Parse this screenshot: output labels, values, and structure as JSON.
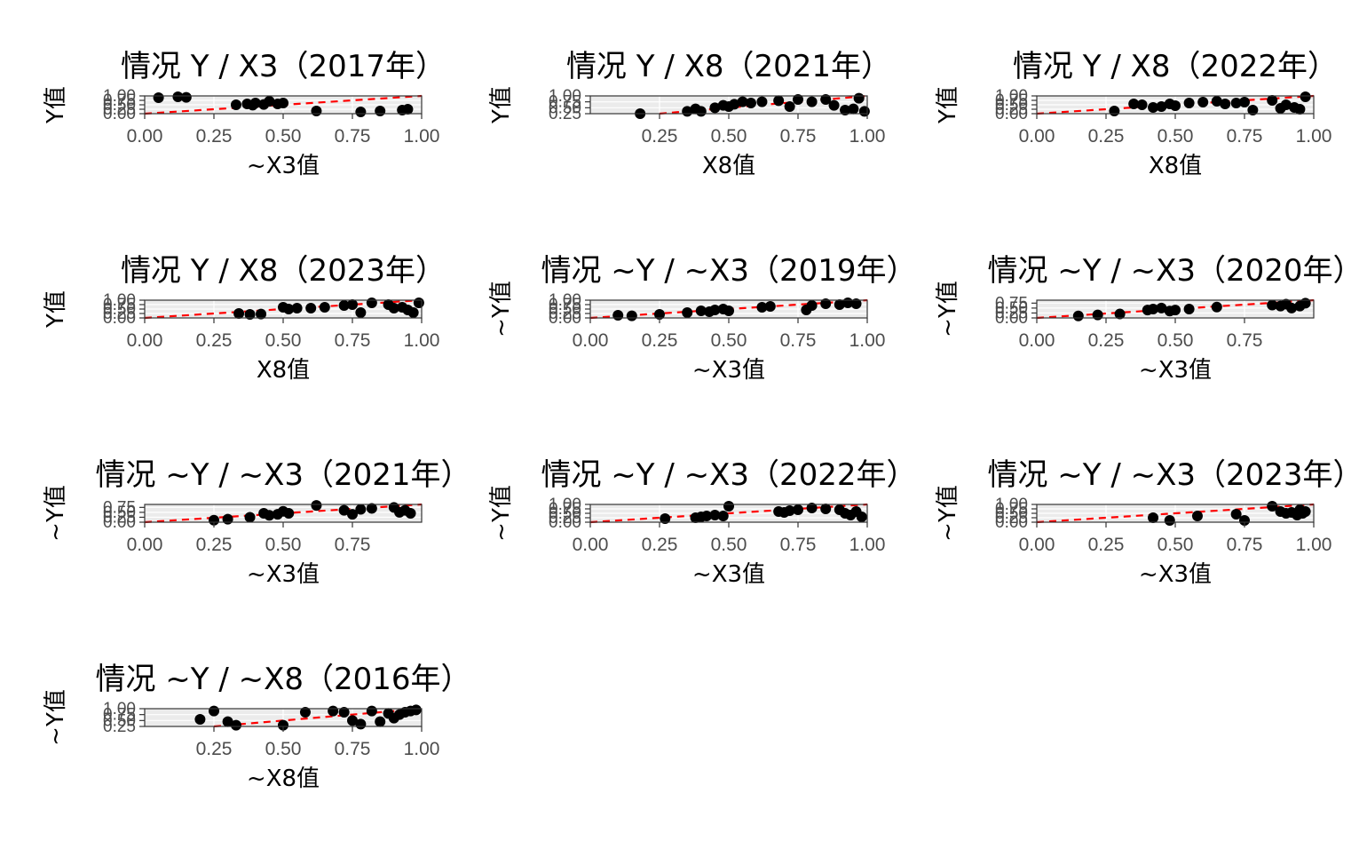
{
  "chart_data": [
    {
      "type": "scatter",
      "title": "情况 Y / X3（2017年）",
      "xlabel": "~X3值",
      "ylabel": "Y值",
      "xlim": [
        0,
        1
      ],
      "ylim": [
        0,
        1
      ],
      "xticks": [
        "0.00",
        "0.25",
        "0.50",
        "0.75",
        "1.00"
      ],
      "yticks": [
        "0.00",
        "0.25",
        "0.50",
        "0.75",
        "1.00"
      ],
      "points": [
        [
          0.05,
          0.9
        ],
        [
          0.12,
          0.95
        ],
        [
          0.15,
          0.92
        ],
        [
          0.33,
          0.5
        ],
        [
          0.37,
          0.55
        ],
        [
          0.39,
          0.48
        ],
        [
          0.4,
          0.6
        ],
        [
          0.43,
          0.52
        ],
        [
          0.45,
          0.7
        ],
        [
          0.48,
          0.55
        ],
        [
          0.5,
          0.6
        ],
        [
          0.62,
          0.15
        ],
        [
          0.78,
          0.1
        ],
        [
          0.85,
          0.15
        ],
        [
          0.93,
          0.2
        ],
        [
          0.95,
          0.25
        ]
      ],
      "trend": [
        [
          0,
          0
        ],
        [
          1,
          1
        ]
      ],
      "grid": true
    },
    {
      "type": "scatter",
      "title": "情况 Y / X8（2021年）",
      "xlabel": "X8值",
      "ylabel": "Y值",
      "xlim": [
        0,
        1
      ],
      "ylim": [
        0.25,
        1
      ],
      "xticks": [
        "0.25",
        "0.50",
        "0.75",
        "1.00"
      ],
      "yticks": [
        "0.25",
        "0.50",
        "0.75",
        "1.00"
      ],
      "points": [
        [
          0.18,
          0.25
        ],
        [
          0.35,
          0.35
        ],
        [
          0.38,
          0.45
        ],
        [
          0.4,
          0.35
        ],
        [
          0.45,
          0.5
        ],
        [
          0.48,
          0.6
        ],
        [
          0.5,
          0.55
        ],
        [
          0.52,
          0.65
        ],
        [
          0.55,
          0.75
        ],
        [
          0.58,
          0.7
        ],
        [
          0.62,
          0.75
        ],
        [
          0.68,
          0.8
        ],
        [
          0.72,
          0.55
        ],
        [
          0.75,
          0.85
        ],
        [
          0.8,
          0.75
        ],
        [
          0.85,
          0.85
        ],
        [
          0.88,
          0.6
        ],
        [
          0.92,
          0.4
        ],
        [
          0.95,
          0.45
        ],
        [
          0.97,
          0.9
        ],
        [
          0.99,
          0.35
        ]
      ],
      "trend": [
        [
          0.25,
          0.25
        ],
        [
          1,
          1
        ]
      ],
      "grid": true
    },
    {
      "type": "scatter",
      "title": "情况 Y / X8（2022年）",
      "xlabel": "X8值",
      "ylabel": "Y值",
      "xlim": [
        0,
        1
      ],
      "ylim": [
        0,
        1
      ],
      "xticks": [
        "0.00",
        "0.25",
        "0.50",
        "0.75",
        "1.00"
      ],
      "yticks": [
        "0.00",
        "0.25",
        "0.50",
        "0.75",
        "1.00"
      ],
      "points": [
        [
          0.28,
          0.15
        ],
        [
          0.35,
          0.55
        ],
        [
          0.38,
          0.5
        ],
        [
          0.42,
          0.35
        ],
        [
          0.45,
          0.4
        ],
        [
          0.48,
          0.55
        ],
        [
          0.5,
          0.45
        ],
        [
          0.55,
          0.6
        ],
        [
          0.6,
          0.65
        ],
        [
          0.65,
          0.7
        ],
        [
          0.68,
          0.55
        ],
        [
          0.72,
          0.6
        ],
        [
          0.75,
          0.65
        ],
        [
          0.78,
          0.2
        ],
        [
          0.85,
          0.75
        ],
        [
          0.88,
          0.3
        ],
        [
          0.9,
          0.5
        ],
        [
          0.93,
          0.35
        ],
        [
          0.95,
          0.25
        ],
        [
          0.97,
          0.95
        ]
      ],
      "trend": [
        [
          0,
          0
        ],
        [
          1,
          1
        ]
      ],
      "grid": true
    },
    {
      "type": "scatter",
      "title": "情况 Y / X8（2023年）",
      "xlabel": "X8值",
      "ylabel": "Y值",
      "xlim": [
        0,
        1
      ],
      "ylim": [
        0,
        1
      ],
      "xticks": [
        "0.00",
        "0.25",
        "0.50",
        "0.75",
        "1.00"
      ],
      "yticks": [
        "0.00",
        "0.25",
        "0.50",
        "0.75",
        "1.00"
      ],
      "points": [
        [
          0.34,
          0.25
        ],
        [
          0.38,
          0.2
        ],
        [
          0.42,
          0.22
        ],
        [
          0.5,
          0.6
        ],
        [
          0.52,
          0.5
        ],
        [
          0.55,
          0.55
        ],
        [
          0.6,
          0.55
        ],
        [
          0.65,
          0.6
        ],
        [
          0.72,
          0.7
        ],
        [
          0.75,
          0.75
        ],
        [
          0.78,
          0.3
        ],
        [
          0.82,
          0.85
        ],
        [
          0.88,
          0.75
        ],
        [
          0.9,
          0.55
        ],
        [
          0.93,
          0.6
        ],
        [
          0.95,
          0.45
        ],
        [
          0.97,
          0.3
        ],
        [
          0.99,
          0.85
        ]
      ],
      "trend": [
        [
          0,
          0
        ],
        [
          1,
          1
        ]
      ],
      "grid": true
    },
    {
      "type": "scatter",
      "title": "情况 ~Y / ~X3（2019年）",
      "xlabel": "~X3值",
      "ylabel": "~Y值",
      "xlim": [
        0,
        1
      ],
      "ylim": [
        0,
        1
      ],
      "xticks": [
        "0.00",
        "0.25",
        "0.50",
        "0.75",
        "1.00"
      ],
      "yticks": [
        "0.00",
        "0.25",
        "0.50",
        "0.75",
        "1.00"
      ],
      "points": [
        [
          0.1,
          0.15
        ],
        [
          0.15,
          0.12
        ],
        [
          0.25,
          0.2
        ],
        [
          0.35,
          0.3
        ],
        [
          0.4,
          0.4
        ],
        [
          0.43,
          0.35
        ],
        [
          0.45,
          0.45
        ],
        [
          0.48,
          0.5
        ],
        [
          0.5,
          0.4
        ],
        [
          0.62,
          0.6
        ],
        [
          0.65,
          0.65
        ],
        [
          0.78,
          0.45
        ],
        [
          0.8,
          0.7
        ],
        [
          0.85,
          0.8
        ],
        [
          0.9,
          0.75
        ],
        [
          0.93,
          0.85
        ],
        [
          0.96,
          0.8
        ]
      ],
      "trend": [
        [
          0,
          0
        ],
        [
          1,
          1
        ]
      ],
      "grid": true
    },
    {
      "type": "scatter",
      "title": "情况 ~Y / ~X3（2020年）",
      "xlabel": "~X3值",
      "ylabel": "~Y值",
      "xlim": [
        0,
        1
      ],
      "ylim": [
        0,
        0.9
      ],
      "xticks": [
        "0.00",
        "0.25",
        "0.50",
        "0.75"
      ],
      "yticks": [
        "0.00",
        "0.25",
        "0.50",
        "0.75"
      ],
      "points": [
        [
          0.15,
          0.1
        ],
        [
          0.22,
          0.15
        ],
        [
          0.3,
          0.2
        ],
        [
          0.4,
          0.4
        ],
        [
          0.42,
          0.45
        ],
        [
          0.45,
          0.5
        ],
        [
          0.48,
          0.35
        ],
        [
          0.5,
          0.4
        ],
        [
          0.55,
          0.45
        ],
        [
          0.65,
          0.55
        ],
        [
          0.85,
          0.65
        ],
        [
          0.88,
          0.6
        ],
        [
          0.9,
          0.7
        ],
        [
          0.92,
          0.5
        ],
        [
          0.95,
          0.6
        ],
        [
          0.97,
          0.75
        ]
      ],
      "trend": [
        [
          0,
          0
        ],
        [
          1,
          0.9
        ]
      ],
      "grid": true
    },
    {
      "type": "scatter",
      "title": "情况 ~Y / ~X3（2021年）",
      "xlabel": "~X3值",
      "ylabel": "~Y值",
      "xlim": [
        0,
        1
      ],
      "ylim": [
        0,
        0.9
      ],
      "xticks": [
        "0.00",
        "0.25",
        "0.50",
        "0.75"
      ],
      "yticks": [
        "0.00",
        "0.25",
        "0.50",
        "0.75"
      ],
      "points": [
        [
          0.25,
          0.1
        ],
        [
          0.3,
          0.15
        ],
        [
          0.38,
          0.25
        ],
        [
          0.43,
          0.45
        ],
        [
          0.45,
          0.35
        ],
        [
          0.48,
          0.4
        ],
        [
          0.5,
          0.55
        ],
        [
          0.52,
          0.45
        ],
        [
          0.62,
          0.85
        ],
        [
          0.72,
          0.6
        ],
        [
          0.75,
          0.4
        ],
        [
          0.78,
          0.65
        ],
        [
          0.82,
          0.7
        ],
        [
          0.9,
          0.75
        ],
        [
          0.92,
          0.5
        ],
        [
          0.94,
          0.6
        ],
        [
          0.96,
          0.45
        ]
      ],
      "trend": [
        [
          0,
          0
        ],
        [
          1,
          0.9
        ]
      ],
      "grid": true
    },
    {
      "type": "scatter",
      "title": "情况 ~Y / ~X3（2022年）",
      "xlabel": "~X3值",
      "ylabel": "~Y值",
      "xlim": [
        0,
        1
      ],
      "ylim": [
        0,
        1
      ],
      "xticks": [
        "0.00",
        "0.25",
        "0.50",
        "0.75",
        "1.00"
      ],
      "yticks": [
        "0.00",
        "0.25",
        "0.50",
        "0.75",
        "1.00"
      ],
      "points": [
        [
          0.27,
          0.2
        ],
        [
          0.38,
          0.25
        ],
        [
          0.4,
          0.3
        ],
        [
          0.42,
          0.35
        ],
        [
          0.45,
          0.4
        ],
        [
          0.48,
          0.35
        ],
        [
          0.5,
          0.9
        ],
        [
          0.68,
          0.6
        ],
        [
          0.7,
          0.55
        ],
        [
          0.72,
          0.65
        ],
        [
          0.75,
          0.7
        ],
        [
          0.8,
          0.8
        ],
        [
          0.85,
          0.75
        ],
        [
          0.9,
          0.7
        ],
        [
          0.92,
          0.5
        ],
        [
          0.94,
          0.4
        ],
        [
          0.96,
          0.6
        ],
        [
          0.98,
          0.3
        ]
      ],
      "trend": [
        [
          0,
          0
        ],
        [
          1,
          1
        ]
      ],
      "grid": true
    },
    {
      "type": "scatter",
      "title": "情况 ~Y / ~X3（2023年）",
      "xlabel": "~X3值",
      "ylabel": "~Y值",
      "xlim": [
        0,
        1
      ],
      "ylim": [
        0,
        1
      ],
      "xticks": [
        "0.00",
        "0.25",
        "0.50",
        "0.75",
        "1.00"
      ],
      "yticks": [
        "0.00",
        "0.25",
        "0.50",
        "0.75",
        "1.00"
      ],
      "points": [
        [
          0.42,
          0.25
        ],
        [
          0.48,
          0.1
        ],
        [
          0.58,
          0.35
        ],
        [
          0.72,
          0.45
        ],
        [
          0.75,
          0.1
        ],
        [
          0.85,
          0.9
        ],
        [
          0.88,
          0.6
        ],
        [
          0.9,
          0.5
        ],
        [
          0.92,
          0.55
        ],
        [
          0.94,
          0.4
        ],
        [
          0.95,
          0.7
        ],
        [
          0.96,
          0.5
        ],
        [
          0.97,
          0.6
        ]
      ],
      "trend": [
        [
          0,
          0
        ],
        [
          1,
          1
        ]
      ],
      "grid": true
    },
    {
      "type": "scatter",
      "title": "情况 ~Y / ~X8（2016年）",
      "xlabel": "~X8值",
      "ylabel": "~Y值",
      "xlim": [
        0,
        1
      ],
      "ylim": [
        0.25,
        1
      ],
      "xticks": [
        "0.25",
        "0.50",
        "0.75",
        "1.00"
      ],
      "yticks": [
        "0.25",
        "0.50",
        "0.75",
        "1.00"
      ],
      "points": [
        [
          0.2,
          0.55
        ],
        [
          0.25,
          0.9
        ],
        [
          0.3,
          0.45
        ],
        [
          0.33,
          0.3
        ],
        [
          0.5,
          0.3
        ],
        [
          0.58,
          0.85
        ],
        [
          0.68,
          0.9
        ],
        [
          0.72,
          0.85
        ],
        [
          0.75,
          0.5
        ],
        [
          0.78,
          0.35
        ],
        [
          0.82,
          0.9
        ],
        [
          0.85,
          0.45
        ],
        [
          0.88,
          0.8
        ],
        [
          0.9,
          0.6
        ],
        [
          0.92,
          0.75
        ],
        [
          0.94,
          0.85
        ],
        [
          0.96,
          0.9
        ],
        [
          0.98,
          0.95
        ]
      ],
      "trend": [
        [
          0.25,
          0.25
        ],
        [
          1,
          1
        ]
      ],
      "grid": true
    }
  ]
}
